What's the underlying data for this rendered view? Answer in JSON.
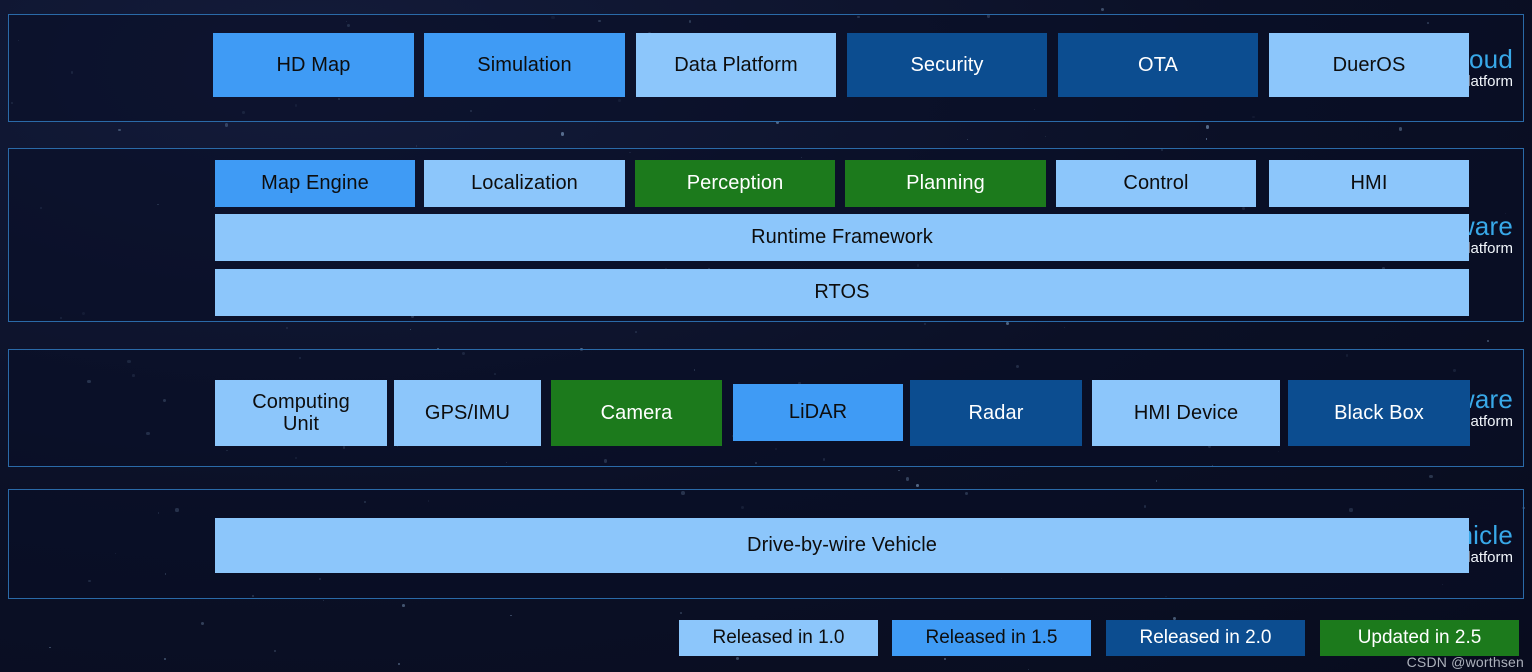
{
  "colors": {
    "released_1_0": "#8cc6fb",
    "released_1_5": "#3f9bf5",
    "released_2_0": "#0c4d90",
    "updated_2_5": "#1c7a1c",
    "panel_border": "#2a6aa8",
    "heading": "#38a8e8",
    "background": "#0a0f24"
  },
  "rows": [
    {
      "id": "cloud",
      "title": "Cloud",
      "subtitle": "Service Platform",
      "blocks": [
        {
          "label": "HD Map",
          "color": "released_1_5"
        },
        {
          "label": "Simulation",
          "color": "released_1_5"
        },
        {
          "label": "Data Platform",
          "color": "released_1_0"
        },
        {
          "label": "Security",
          "color": "released_2_0"
        },
        {
          "label": "OTA",
          "color": "released_2_0"
        },
        {
          "label": "DuerOS",
          "color": "released_1_0"
        }
      ]
    },
    {
      "id": "software",
      "title": "Software",
      "subtitle": "Open Platform",
      "blocks": [
        {
          "label": "Map Engine",
          "color": "released_1_5"
        },
        {
          "label": "Localization",
          "color": "released_1_0"
        },
        {
          "label": "Perception",
          "color": "updated_2_5"
        },
        {
          "label": "Planning",
          "color": "updated_2_5"
        },
        {
          "label": "Control",
          "color": "released_1_0"
        },
        {
          "label": "HMI",
          "color": "released_1_0"
        }
      ],
      "full_width_blocks": [
        {
          "label": "Runtime Framework",
          "color": "released_1_0"
        },
        {
          "label": "RTOS",
          "color": "released_1_0"
        }
      ]
    },
    {
      "id": "hardware",
      "title": "Hardware",
      "subtitle": "Reference Platform",
      "blocks": [
        {
          "label": "Computing\nUnit",
          "color": "released_1_0"
        },
        {
          "label": "GPS/IMU",
          "color": "released_1_0"
        },
        {
          "label": "Camera",
          "color": "updated_2_5"
        },
        {
          "label": "LiDAR",
          "color": "released_1_5"
        },
        {
          "label": "Radar",
          "color": "released_2_0"
        },
        {
          "label": "HMI Device",
          "color": "released_1_0"
        },
        {
          "label": "Black Box",
          "color": "released_2_0"
        }
      ]
    },
    {
      "id": "vehicle",
      "title": "Vehicle",
      "subtitle": "Reference Platform",
      "blocks": [],
      "full_width_blocks": [
        {
          "label": "Drive-by-wire Vehicle",
          "color": "released_1_0"
        }
      ]
    }
  ],
  "legend": [
    {
      "label": "Released in 1.0",
      "color": "released_1_0"
    },
    {
      "label": "Released in 1.5",
      "color": "released_1_5"
    },
    {
      "label": "Released in 2.0",
      "color": "released_2_0"
    },
    {
      "label": "Updated in 2.5",
      "color": "updated_2_5"
    }
  ],
  "watermark": "CSDN @worthsen"
}
